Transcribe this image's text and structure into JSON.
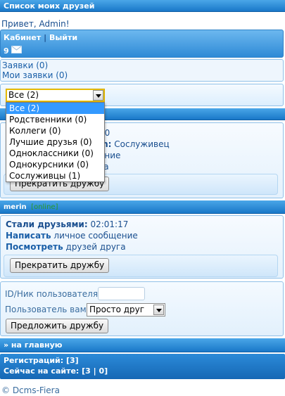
{
  "page_title": "Список моих друзей",
  "greeting": "Привет, Admin!",
  "user_bar": {
    "cabinet": "Кабинет",
    "separator": "|",
    "logout": "Выйти",
    "mail_count": "9"
  },
  "requests": {
    "incoming": "Заявки (0)",
    "mine": "Мои заявки (0)"
  },
  "filter": {
    "selected": "Все (2)",
    "options": [
      "Все (2)",
      "Родственники (0)",
      "Коллеги (0)",
      "Лучшие друзья (0)",
      "Одноклассники (0)",
      "Однокурсники (0)",
      "Сослуживцы (1)"
    ]
  },
  "friend1": {
    "time_fragment": "20",
    "type_label": "in:",
    "type_value": "Сослуживец",
    "message_fragment": "ение",
    "friends_fragment": "га",
    "end_button": "Прекратить дружбу"
  },
  "friend2": {
    "nick": "merin",
    "status": "[online]",
    "since_label": "Стали друзьями:",
    "since_value": "02:01:17",
    "write_label": "Написать",
    "write_value": "личное сообщение",
    "view_label": "Посмотреть",
    "view_value": "друзей друга",
    "end_button": "Прекратить дружбу"
  },
  "offer_form": {
    "id_label": "ID/Ник пользователя:",
    "id_value": "",
    "relation_label": "Пользователь вам",
    "relation_value": "Просто друг",
    "submit": "Предложить дружбу"
  },
  "home_link": "» на главную",
  "stats": {
    "registrations": "Регистраций: [3]",
    "online": "Сейчас на сайте: [3 | 0]"
  },
  "footer": "© Dcms-Fiera",
  "colors": {
    "header_bar": "#1978c8",
    "panel_bg": "#dceefd",
    "link": "#1a5fa8",
    "online": "#2a9a2a",
    "dropdown_highlight": "#3399ff"
  }
}
